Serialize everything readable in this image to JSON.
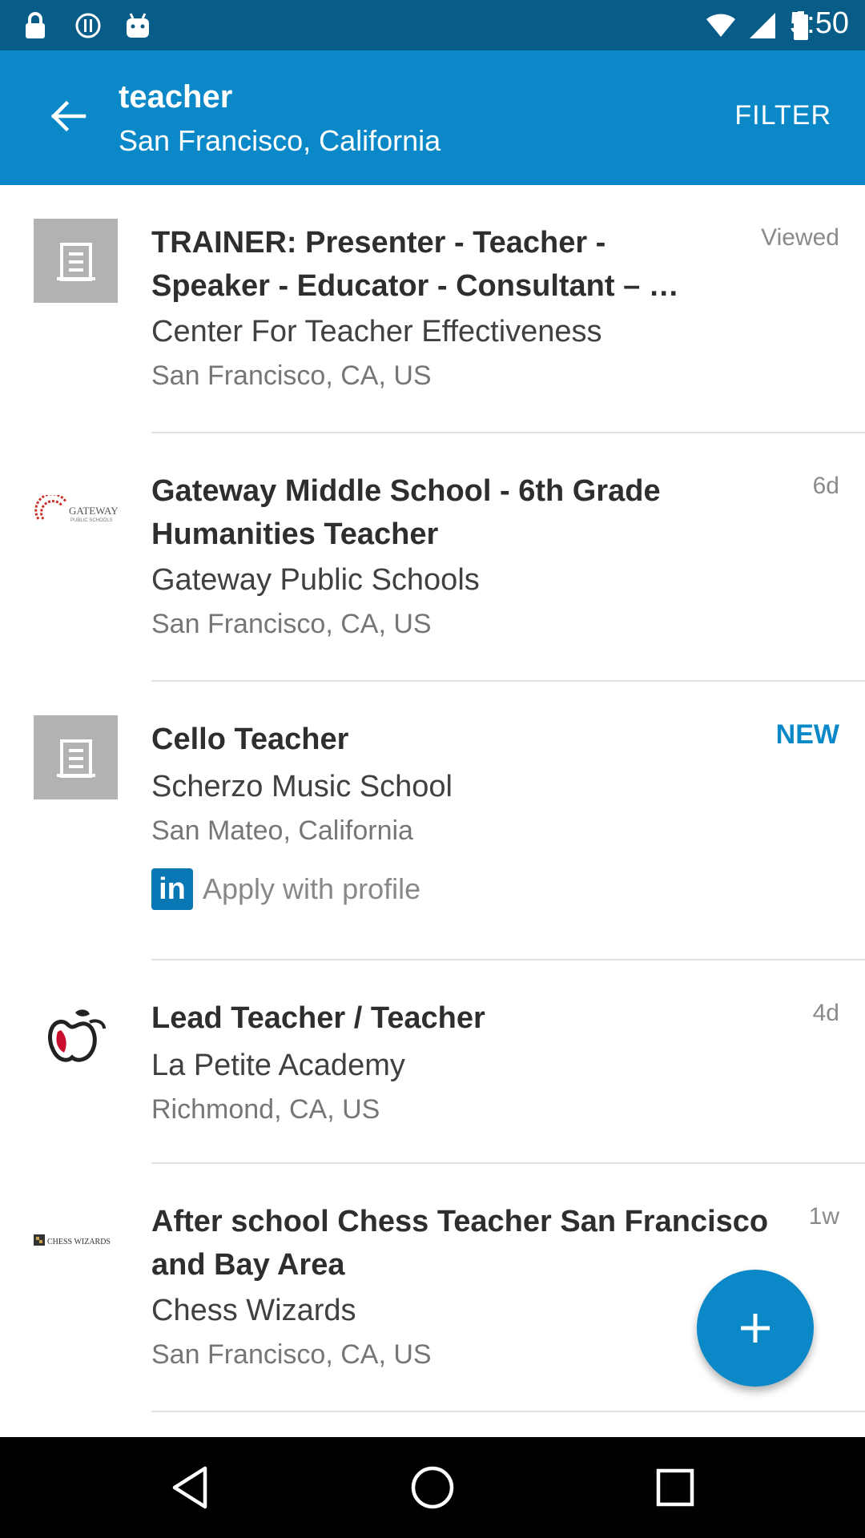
{
  "status_bar": {
    "time": "5:50",
    "icons": [
      "lock-icon",
      "vpn-icon",
      "android-icon",
      "wifi-icon",
      "signal-icon",
      "battery-icon"
    ]
  },
  "app_bar": {
    "query": "teacher",
    "location": "San Francisco, California",
    "filter_label": "FILTER",
    "accent_color": "#0a88c8"
  },
  "jobs": [
    {
      "title": "TRAINER: Presenter - Teacher - Speaker - Educator - Consultant – …",
      "company": "Center For Teacher Effectiveness",
      "location": "San Francisco, CA, US",
      "meta": "Viewed",
      "logo": "building-placeholder-icon"
    },
    {
      "title": "Gateway Middle School - 6th Grade Humanities Teacher",
      "company": "Gateway Public Schools",
      "location": "San Francisco, CA, US",
      "meta": "6d",
      "logo": "gateway-logo",
      "logo_text": "GATEWAY",
      "logo_subtext": "PUBLIC SCHOOLS"
    },
    {
      "title": "Cello Teacher",
      "company": "Scherzo Music School",
      "location": "San Mateo, California",
      "meta": "NEW",
      "logo": "building-placeholder-icon",
      "apply_label": "Apply with profile",
      "apply_badge": "in"
    },
    {
      "title": "Lead Teacher / Teacher",
      "company": "La Petite Academy",
      "location": "Richmond, CA, US",
      "meta": "4d",
      "logo": "apple-logo"
    },
    {
      "title": "After school Chess Teacher San Francisco and Bay Area",
      "company": "Chess Wizards",
      "location": "San Francisco, CA, US",
      "meta": "1w",
      "logo": "chess-wizards-logo",
      "logo_text": "CHESS WIZARDS"
    }
  ],
  "fab": {
    "icon": "plus-icon"
  },
  "nav_bar": {
    "icons": [
      "back-triangle-icon",
      "home-circle-icon",
      "recents-square-icon"
    ]
  }
}
